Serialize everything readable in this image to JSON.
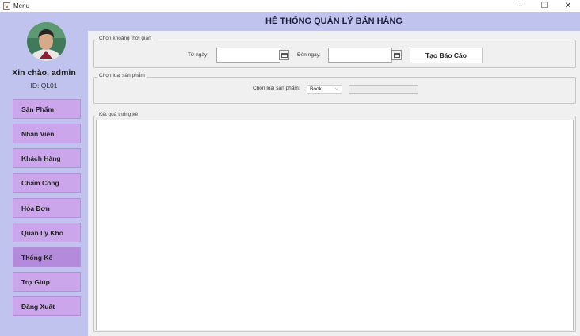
{
  "window": {
    "title": "Menu",
    "minimize": "–",
    "maximize": "☐",
    "close": "✕"
  },
  "sidebar": {
    "greeting": "Xin chào, admin",
    "user_id": "ID: QL01",
    "items": [
      {
        "label": "Sản Phẩm"
      },
      {
        "label": "Nhân Viên"
      },
      {
        "label": "Khách Hàng"
      },
      {
        "label": "Chấm Công"
      },
      {
        "label": "Hóa Đơn"
      },
      {
        "label": "Quản Lý Kho"
      },
      {
        "label": "Thống Kê",
        "active": true
      },
      {
        "label": "Trợ Giúp"
      },
      {
        "label": "Đăng Xuất"
      }
    ]
  },
  "header": {
    "title": "HỆ THỐNG QUẢN LÝ BÁN HÀNG"
  },
  "time_range": {
    "legend": "Chọn khoảng thời gian",
    "from_label": "Từ ngày:",
    "from_value": "",
    "to_label": "Đến ngày:",
    "to_value": "",
    "report_button": "Tạo Báo Cáo"
  },
  "product_type": {
    "legend": "Chọn loại sản phẩm",
    "select_label": "Chọn loại sản phẩm:",
    "selected": "Book",
    "field_value": ""
  },
  "results": {
    "legend": "Kết quả thống kê"
  },
  "colors": {
    "sidebar_bg": "#c0c3ee",
    "nav_button": "#cba6ea",
    "nav_active": "#b48bdc"
  }
}
